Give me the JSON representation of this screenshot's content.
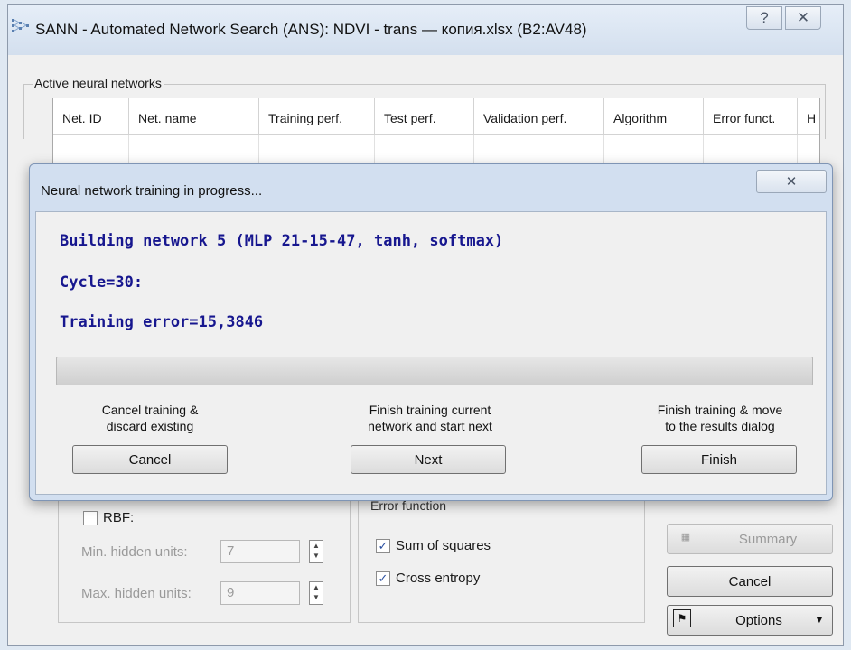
{
  "main_window": {
    "title": "SANN - Automated Network Search (ANS): NDVI - trans — копия.xlsx (B2:AV48)",
    "help_glyph": "?",
    "close_glyph": "✕"
  },
  "active_networks": {
    "legend": "Active neural networks",
    "columns": [
      "Net. ID",
      "Net. name",
      "Training perf.",
      "Test perf.",
      "Validation perf.",
      "Algorithm",
      "Error funct.",
      "H"
    ]
  },
  "progress_dialog": {
    "title": "Neural network training in progress...",
    "close_glyph": "✕",
    "status_building": "Building network 5 (MLP 21-15-47, tanh, softmax)",
    "status_cycle": "Cycle=30:",
    "status_error": "Training error=15,3846",
    "progress": 0,
    "cancel_desc_line1": "Cancel training &",
    "cancel_desc_line2": "discard existing",
    "cancel_label": "Cancel",
    "next_desc_line1": "Finish training current",
    "next_desc_line2": "network and start next",
    "next_label": "Next",
    "finish_desc_line1": "Finish training & move",
    "finish_desc_line2": "to the results dialog",
    "finish_label": "Finish"
  },
  "rbf": {
    "label": "RBF:",
    "checked": false,
    "min_label": "Min. hidden units:",
    "min_value": "7",
    "max_label": "Max. hidden units:",
    "max_value": "9"
  },
  "error_function": {
    "legend": "Error function",
    "sum_of_squares": "Sum of squares",
    "sum_checked": true,
    "cross_entropy": "Cross entropy",
    "cross_checked": true
  },
  "side_buttons": {
    "summary": "Summary",
    "cancel": "Cancel",
    "options": "Options"
  },
  "icons": {
    "app": "network-grid-icon",
    "summary": "spreadsheet-icon",
    "options": "options-icon",
    "check": "checkmark-icon"
  },
  "colors": {
    "status_text": "#17178f",
    "progress_fill": "#37b837",
    "dialog_frame": "#d2dff0"
  }
}
